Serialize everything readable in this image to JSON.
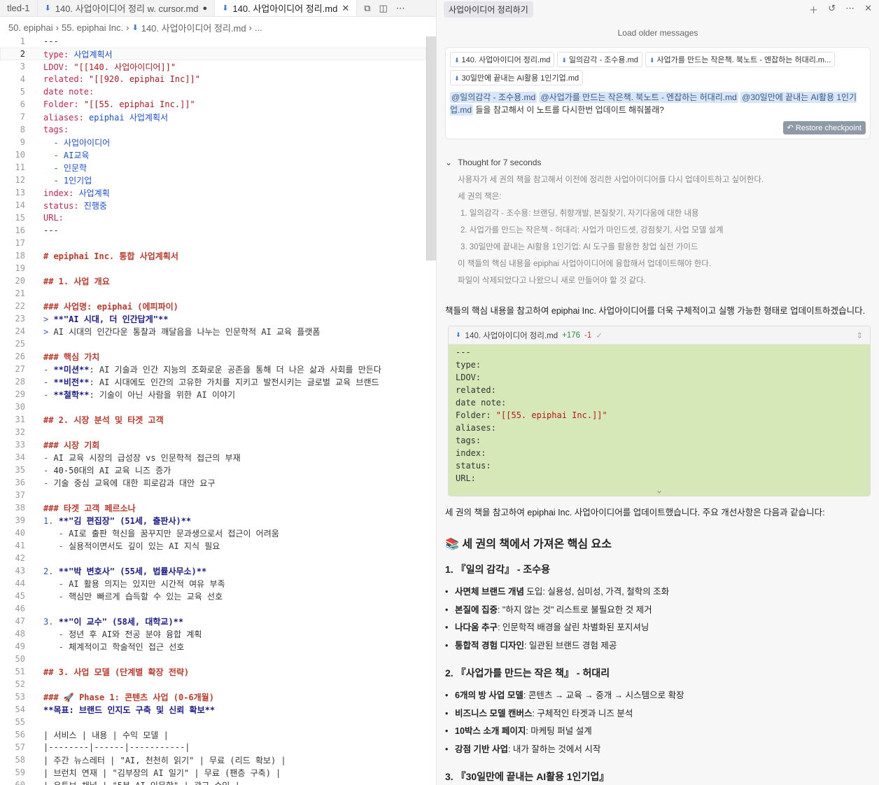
{
  "tabs": [
    {
      "label": "tled-1"
    },
    {
      "label": "140. 사업아이디어 정리 w. cursor.md",
      "modified": true
    },
    {
      "label": "140. 사업아이디어 정리.md",
      "active": true
    }
  ],
  "breadcrumb": [
    "50. epiphai",
    "55. epiphai Inc.",
    "140. 사업아이디어 정리.md",
    "..."
  ],
  "editor": {
    "lines": [
      [
        {
          "t": "---"
        }
      ],
      [
        {
          "t": "type: ",
          "c": "k"
        },
        {
          "t": "사업계획서",
          "c": "v"
        }
      ],
      [
        {
          "t": "LDOV: ",
          "c": "k"
        },
        {
          "t": "\"[[140. 사업아이디어]]\"",
          "c": "s"
        }
      ],
      [
        {
          "t": "related: ",
          "c": "k"
        },
        {
          "t": "\"[[920. epiphai Inc]]\"",
          "c": "s"
        }
      ],
      [
        {
          "t": "date note:",
          "c": "k"
        }
      ],
      [
        {
          "t": "Folder: ",
          "c": "k"
        },
        {
          "t": "\"[[55. epiphai Inc.]]\"",
          "c": "s"
        }
      ],
      [
        {
          "t": "aliases: ",
          "c": "k"
        },
        {
          "t": "epiphai 사업계획서",
          "c": "v"
        }
      ],
      [
        {
          "t": "tags:",
          "c": "k"
        }
      ],
      [
        {
          "t": "  - ",
          "c": "list"
        },
        {
          "t": "사업아이디어",
          "c": "v"
        }
      ],
      [
        {
          "t": "  - ",
          "c": "list"
        },
        {
          "t": "AI교육",
          "c": "v"
        }
      ],
      [
        {
          "t": "  - ",
          "c": "list"
        },
        {
          "t": "인문학",
          "c": "v"
        }
      ],
      [
        {
          "t": "  - ",
          "c": "list"
        },
        {
          "t": "1인기업",
          "c": "v"
        }
      ],
      [
        {
          "t": "index: ",
          "c": "k"
        },
        {
          "t": "사업계획",
          "c": "v"
        }
      ],
      [
        {
          "t": "status: ",
          "c": "k"
        },
        {
          "t": "진행중",
          "c": "v"
        }
      ],
      [
        {
          "t": "URL:",
          "c": "k"
        }
      ],
      [
        {
          "t": "---"
        }
      ],
      [
        {
          "t": ""
        }
      ],
      [
        {
          "t": "# epiphai Inc. 통합 사업계획서",
          "c": "h"
        }
      ],
      [
        {
          "t": ""
        }
      ],
      [
        {
          "t": "## 1. 사업 개요",
          "c": "h"
        }
      ],
      [
        {
          "t": ""
        }
      ],
      [
        {
          "t": "### 사업명: epiphai (에피파이)",
          "c": "h"
        }
      ],
      [
        {
          "t": "> ",
          "c": "q"
        },
        {
          "t": "**\"AI 시대, 더 인간답게\"**",
          "c": "b"
        }
      ],
      [
        {
          "t": "> ",
          "c": "q"
        },
        {
          "t": "AI 시대의 인간다운 통찰과 깨달음을 나누는 인문학적 AI 교육 플랫폼"
        }
      ],
      [
        {
          "t": ""
        }
      ],
      [
        {
          "t": "### 핵심 가치",
          "c": "h"
        }
      ],
      [
        {
          "t": "- ",
          "c": "list"
        },
        {
          "t": "**미션**",
          "c": "b"
        },
        {
          "t": ": AI 기술과 인간 지능의 조화로운 공존을 통해 더 나은 삶과 사회를 만든다"
        }
      ],
      [
        {
          "t": "- ",
          "c": "list"
        },
        {
          "t": "**비전**",
          "c": "b"
        },
        {
          "t": ": AI 시대에도 인간의 고유한 가치를 지키고 발전시키는 글로벌 교육 브랜드"
        }
      ],
      [
        {
          "t": "- ",
          "c": "list"
        },
        {
          "t": "**철학**",
          "c": "b"
        },
        {
          "t": ": 기술이 아닌 사람을 위한 AI 이야기"
        }
      ],
      [
        {
          "t": ""
        }
      ],
      [
        {
          "t": "## 2. 시장 분석 및 타겟 고객",
          "c": "h"
        }
      ],
      [
        {
          "t": ""
        }
      ],
      [
        {
          "t": "### 시장 기회",
          "c": "h"
        }
      ],
      [
        {
          "t": "- ",
          "c": "list"
        },
        {
          "t": "AI 교육 시장의 급성장 vs 인문학적 접근의 부재"
        }
      ],
      [
        {
          "t": "- ",
          "c": "list"
        },
        {
          "t": "40-50대의 AI 교육 니즈 증가"
        }
      ],
      [
        {
          "t": "- ",
          "c": "list"
        },
        {
          "t": "기술 중심 교육에 대한 피로감과 대안 요구"
        }
      ],
      [
        {
          "t": ""
        }
      ],
      [
        {
          "t": "### 타겟 고객 페르소나",
          "c": "h"
        }
      ],
      [
        {
          "t": "1. ",
          "c": "list"
        },
        {
          "t": "**\"김 편집장\" (51세, 출판사)**",
          "c": "b"
        }
      ],
      [
        {
          "t": "   - ",
          "c": "list"
        },
        {
          "t": "AI로 출판 혁신을 꿈꾸지만 문과생으로서 접근이 어려움"
        }
      ],
      [
        {
          "t": "   - ",
          "c": "list"
        },
        {
          "t": "실용적이면서도 깊이 있는 AI 지식 필요"
        }
      ],
      [
        {
          "t": ""
        }
      ],
      [
        {
          "t": "2. ",
          "c": "list"
        },
        {
          "t": "**\"박 변호사\" (55세, 법률사무소)**",
          "c": "b"
        }
      ],
      [
        {
          "t": "   - ",
          "c": "list"
        },
        {
          "t": "AI 활용 의지는 있지만 시간적 여유 부족"
        }
      ],
      [
        {
          "t": "   - ",
          "c": "list"
        },
        {
          "t": "핵심만 빠르게 습득할 수 있는 교육 선호"
        }
      ],
      [
        {
          "t": ""
        }
      ],
      [
        {
          "t": "3. ",
          "c": "list"
        },
        {
          "t": "**\"이 교수\" (58세, 대학교)**",
          "c": "b"
        }
      ],
      [
        {
          "t": "   - ",
          "c": "list"
        },
        {
          "t": "정년 후 AI와 전공 분야 융합 계획"
        }
      ],
      [
        {
          "t": "   - ",
          "c": "list"
        },
        {
          "t": "체계적이고 학술적인 접근 선호"
        }
      ],
      [
        {
          "t": ""
        }
      ],
      [
        {
          "t": "## 3. 사업 모델 (단계별 확장 전략)",
          "c": "h"
        }
      ],
      [
        {
          "t": ""
        }
      ],
      [
        {
          "t": "### 🚀 Phase 1: 콘텐츠 사업 (0-6개월)",
          "c": "h"
        }
      ],
      [
        {
          "t": "**목표: 브랜드 인지도 구축 및 신뢰 확보**",
          "c": "b"
        }
      ],
      [
        {
          "t": ""
        }
      ],
      [
        {
          "t": "| 서비스 | 내용 | 수익 모델 |"
        }
      ],
      [
        {
          "t": "|--------|------|-----------|"
        }
      ],
      [
        {
          "t": "| 주간 뉴스레터 | \"AI, 천천히 읽기\" | 무료 (리드 확보) |"
        }
      ],
      [
        {
          "t": "| 브런치 연재 | \"김부장의 AI 일기\" | 무료 (팬층 구축) |"
        }
      ],
      [
        {
          "t": "| 유튜브 채널 | \"5분 AI 인문학\" | 광고 수익 |"
        }
      ]
    ]
  },
  "chat": {
    "title": "사업아이디어 정리하기",
    "older_label": "Load older messages",
    "chips": [
      "140. 사업아이디어 정리.md",
      "일의감각 - 조수용.md",
      "사업가를 만드는 작은책. 북노트 - 엔잡하는 허대리.m...",
      "30일만에 끝내는 AI활용 1인기업.md"
    ],
    "mentions": [
      "@일의감각 - 조수용.md",
      "@사업가를 만드는 작은책. 북노트 - 엔잡하는 허대리.md",
      "@30일만에 끝내는 AI활용 1인기업.md"
    ],
    "user_text": " 들을 참고해서 이 노트를 다시한번 업데이트 해줘볼래?",
    "restore_label": "Restore checkpoint",
    "thought_label": "Thought for 7 seconds",
    "thought_lines": [
      "사용자가 세 권의 책을 참고해서 이전에 정리한 사업아이디어를 다시 업데이트하고 싶어한다.",
      "세 권의 책은:",
      "1. 일의감각 - 조수용: 브랜딩, 취향개발, 본질찾기, 자기다움에 대한 내용",
      "2. 사업가를 만드는 작은책 - 허대리: 사업가 마인드셋, 강점찾기, 사업 모델 설계",
      "3. 30일만에 끝내는 AI활용 1인기업: AI 도구를 활용한 창업 실전 가이드",
      "이 책들의 핵심 내용을 epiphai 사업아이디어에 융합해서 업데이트해야 한다.",
      "파일이 삭제되었다고 나왔으니 새로 만들어야 할 것 같다."
    ],
    "intro_text": "책들의 핵심 내용을 참고하여 epiphai Inc. 사업아이디어를 더욱 구체적이고 실행 가능한 형태로 업데이트하겠습니다.",
    "diff": {
      "file": "140. 사업아이디어 정리.md",
      "added": "+176",
      "removed": "-1",
      "lines": [
        {
          "k": "---"
        },
        {
          "k": "type:"
        },
        {
          "k": "LDOV:"
        },
        {
          "k": "related:"
        },
        {
          "k": "date note:"
        },
        {
          "k": "Folder: ",
          "v": "\"[[55. epiphai Inc.]]\""
        },
        {
          "k": "aliases:"
        },
        {
          "k": "tags:"
        },
        {
          "k": "index:"
        },
        {
          "k": "status:"
        },
        {
          "k": "URL:"
        }
      ]
    },
    "summary_text": "세 권의 책을 참고하여 epiphai Inc. 사업아이디어를 업데이트했습니다. 주요 개선사항은 다음과 같습니다:",
    "section_title": "📚 세 권의 책에서 가져온 핵심 요소",
    "books": [
      {
        "title": "1. 『일의 감각』 - 조수용",
        "items": [
          {
            "b": "사면체 브랜드 개념",
            "t": " 도입: 실용성, 심미성, 가격, 철학의 조화"
          },
          {
            "b": "본질에 집중",
            "t": ": \"하지 않는 것\" 리스트로 불필요한 것 제거"
          },
          {
            "b": "나다움 추구",
            "t": ": 인문학적 배경을 살린 차별화된 포지셔닝"
          },
          {
            "b": "통합적 경험 디자인",
            "t": ": 일관된 브랜드 경험 제공"
          }
        ]
      },
      {
        "title": "2. 『사업가를 만드는 작은 책』 - 허대리",
        "items": [
          {
            "b": "6개의 방 사업 모델",
            "t": ": 콘텐츠 → 교육 → 중개 → 시스템으로 확장"
          },
          {
            "b": "비즈니스 모델 캔버스",
            "t": ": 구체적인 타겟과 니즈 분석"
          },
          {
            "b": "10박스 소개 페이지",
            "t": ": 마케팅 퍼널 설계"
          },
          {
            "b": "강점 기반 사업",
            "t": ": 내가 잘하는 것에서 시작"
          }
        ]
      },
      {
        "title": "3. 『30일만에 끝내는 AI활용 1인기업』",
        "items": []
      }
    ]
  }
}
